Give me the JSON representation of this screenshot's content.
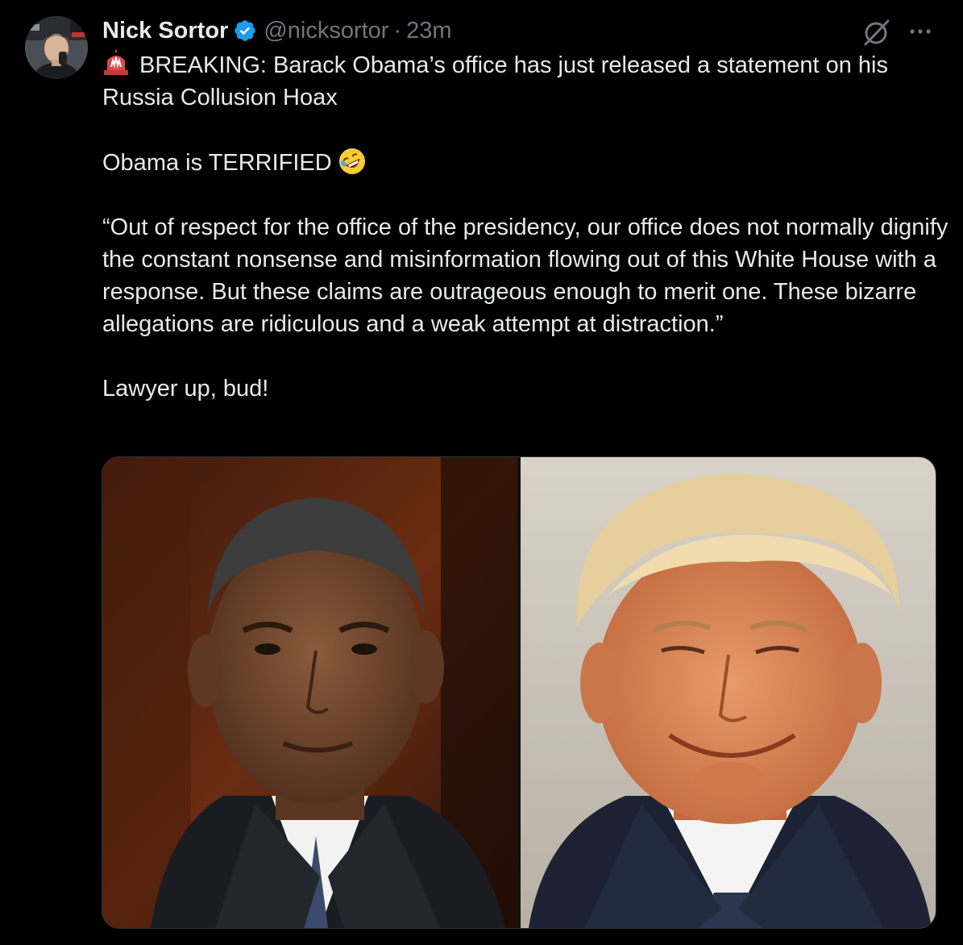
{
  "author": {
    "display_name": "Nick Sortor",
    "handle": "@nicksortor",
    "separator": "·",
    "timestamp": "23m",
    "verified_color": "#1d9bf0"
  },
  "post": {
    "line1": "BREAKING: Barack Obama’s office has just released a statement on his Russia Collusion Hoax",
    "line2": "Obama is TERRIFIED",
    "quote": "“Out of respect for the office of the presidency, our office does not normally dignify the constant nonsense and misinformation flowing out of this White House with a response. But these claims are outrageous enough to merit one. These bizarre allegations are ridiculous and a weak attempt at distraction.”",
    "closing": "Lawyer up, bud!"
  },
  "icons": {
    "siren": "siren-emoji",
    "rofl": "rofl-emoji",
    "grok": "grok-icon",
    "more": "more-icon",
    "verified": "verified-badge-icon"
  },
  "media": {
    "count": 2
  },
  "colors": {
    "background": "#000000",
    "text": "#e7e9ea",
    "muted": "#71767b",
    "accent": "#1d9bf0"
  }
}
